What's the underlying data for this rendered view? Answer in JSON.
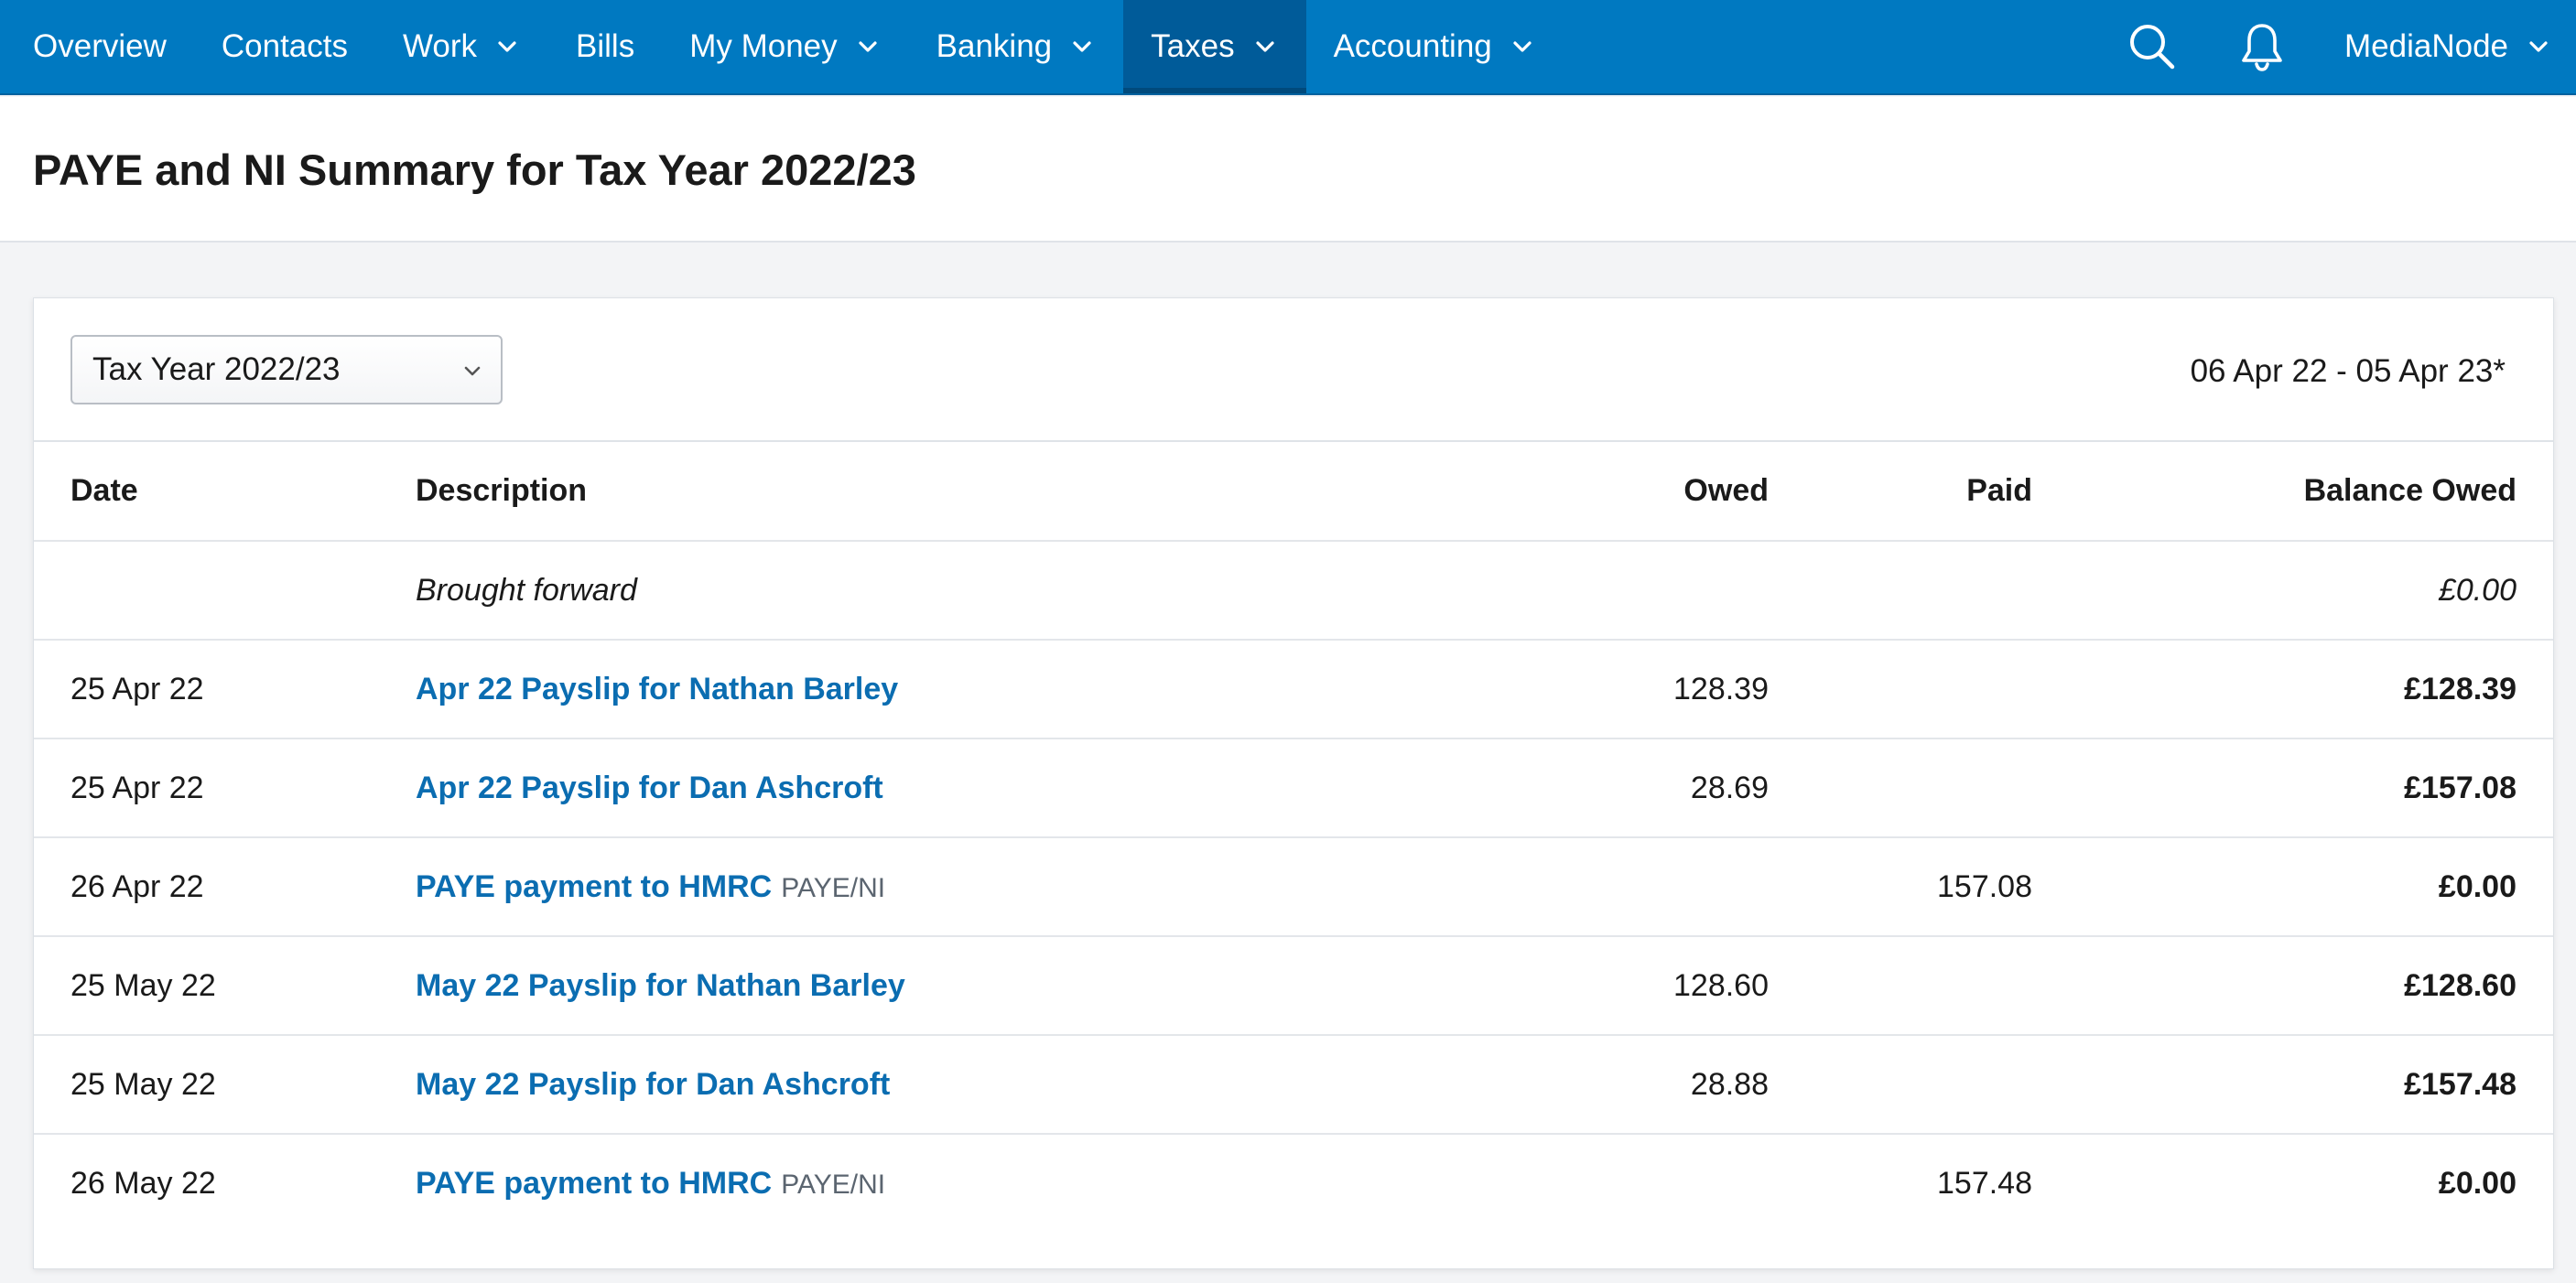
{
  "nav": {
    "items": [
      {
        "label": "Overview",
        "dropdown": false
      },
      {
        "label": "Contacts",
        "dropdown": false
      },
      {
        "label": "Work",
        "dropdown": true
      },
      {
        "label": "Bills",
        "dropdown": false
      },
      {
        "label": "My Money",
        "dropdown": true
      },
      {
        "label": "Banking",
        "dropdown": true
      },
      {
        "label": "Taxes",
        "dropdown": true,
        "active": true
      },
      {
        "label": "Accounting",
        "dropdown": true
      }
    ],
    "account_label": "MediaNode",
    "colors": {
      "bar": "#0079c1",
      "active": "#005b99"
    }
  },
  "page": {
    "title": "PAYE and NI Summary for Tax Year 2022/23"
  },
  "filter": {
    "selected": "Tax Year 2022/23",
    "date_range": "06 Apr 22 - 05 Apr 23*"
  },
  "table": {
    "headers": {
      "date": "Date",
      "description": "Description",
      "owed": "Owed",
      "paid": "Paid",
      "balance": "Balance Owed"
    },
    "brought_forward": {
      "description": "Brought forward",
      "balance": "£0.00"
    },
    "rows": [
      {
        "date": "25 Apr 22",
        "description": "Apr 22 Payslip for Nathan Barley",
        "tag": "",
        "owed": "128.39",
        "paid": "",
        "balance": "£128.39"
      },
      {
        "date": "25 Apr 22",
        "description": "Apr 22 Payslip for Dan Ashcroft",
        "tag": "",
        "owed": "28.69",
        "paid": "",
        "balance": "£157.08"
      },
      {
        "date": "26 Apr 22",
        "description": "PAYE payment to HMRC",
        "tag": "PAYE/NI",
        "owed": "",
        "paid": "157.08",
        "balance": "£0.00"
      },
      {
        "date": "25 May 22",
        "description": "May 22 Payslip for Nathan Barley",
        "tag": "",
        "owed": "128.60",
        "paid": "",
        "balance": "£128.60"
      },
      {
        "date": "25 May 22",
        "description": "May 22 Payslip for Dan Ashcroft",
        "tag": "",
        "owed": "28.88",
        "paid": "",
        "balance": "£157.48"
      },
      {
        "date": "26 May 22",
        "description": "PAYE payment to HMRC",
        "tag": "PAYE/NI",
        "owed": "",
        "paid": "157.48",
        "balance": "£0.00"
      }
    ]
  }
}
